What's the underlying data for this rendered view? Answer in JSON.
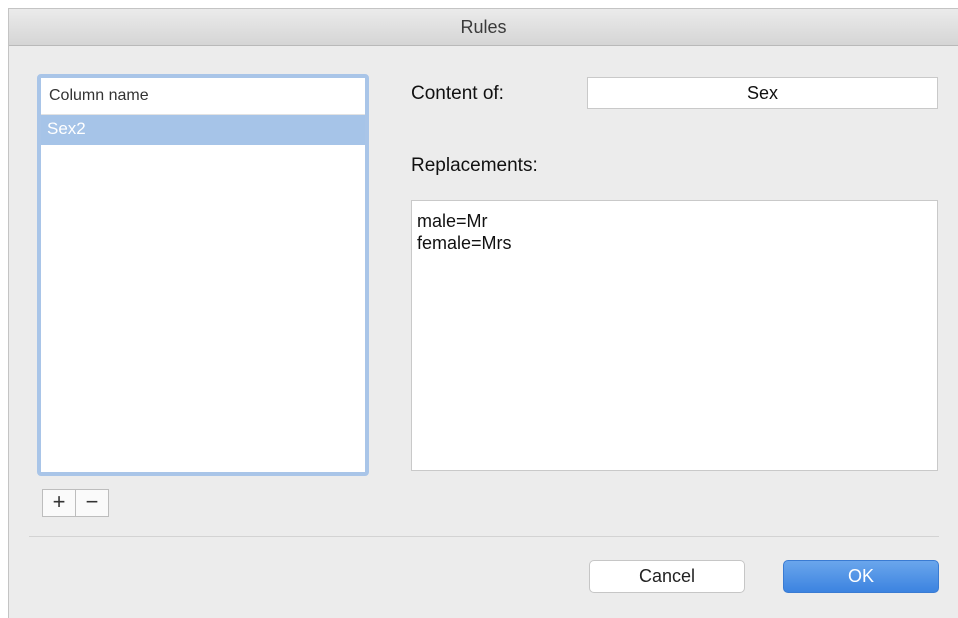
{
  "window": {
    "title": "Rules"
  },
  "column_list": {
    "header": "Column name",
    "items": [
      {
        "label": "Sex2",
        "selected": true
      }
    ],
    "add_symbol": "+",
    "remove_symbol": "−"
  },
  "form": {
    "content_of_label": "Content of:",
    "content_of_value": "Sex",
    "replacements_label": "Replacements:",
    "replacements_lines": [
      "male=Mr",
      "female=Mrs"
    ]
  },
  "buttons": {
    "cancel": "Cancel",
    "ok": "OK"
  },
  "colors": {
    "selection": "#a6c4e8",
    "focus_ring": "#a9c5e8",
    "ok_button": "#3c83e0"
  }
}
